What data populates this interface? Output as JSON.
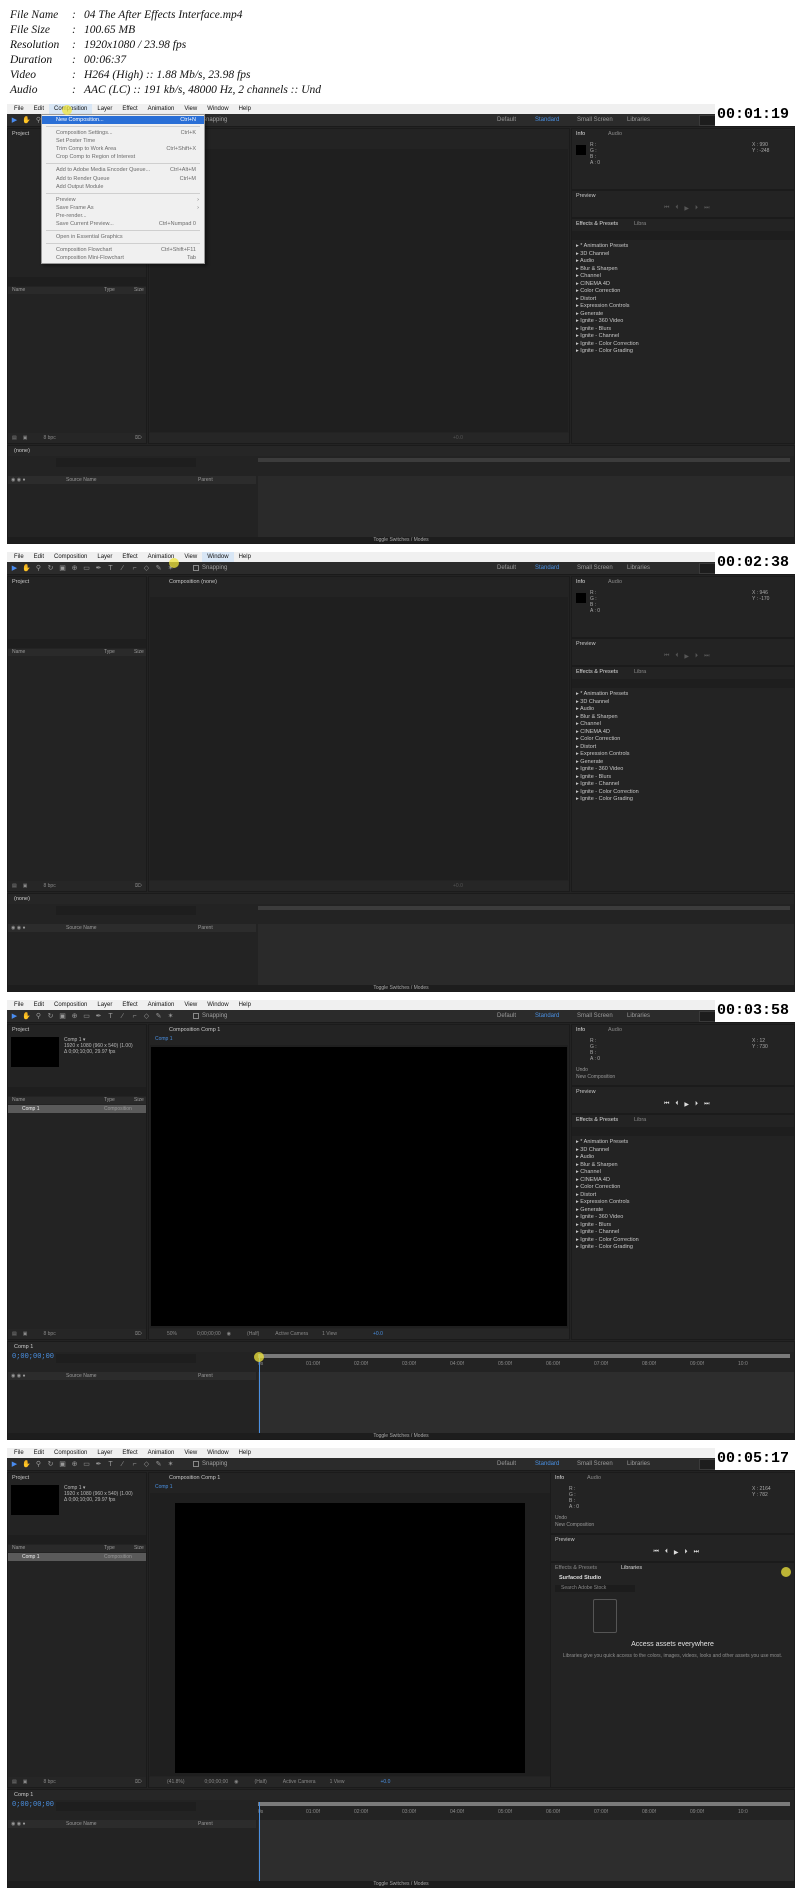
{
  "meta": {
    "rows": [
      {
        "key": "File Name",
        "value": "04 The After Effects Interface.mp4"
      },
      {
        "key": "File Size",
        "value": "100.65 MB"
      },
      {
        "key": "Resolution",
        "value": "1920x1080 / 23.98 fps"
      },
      {
        "key": "Duration",
        "value": "00:06:37"
      },
      {
        "key": "Video",
        "value": "H264 (High) :: 1.88 Mb/s, 23.98 fps"
      },
      {
        "key": "Audio",
        "value": "AAC (LC) :: 191 kb/s, 48000 Hz, 2 channels :: Und"
      }
    ],
    "separator": ":"
  },
  "app": {
    "menus": [
      "File",
      "Edit",
      "Composition",
      "Layer",
      "Effect",
      "Animation",
      "View",
      "Window",
      "Help"
    ],
    "snapping": "Snapping",
    "workspaces": [
      "Default",
      "Standard",
      "Small Screen",
      "Libraries"
    ],
    "search_placeholder": "Search Help",
    "project_title": "Project",
    "name_col": "Name",
    "type_col": "Type",
    "size_col": "Size",
    "info_tab": "Info",
    "audio_tab": "Audio",
    "preview_tab": "Preview",
    "effects_tab": "Effects & Presets",
    "libraries_tab": "Libra",
    "libraries_tab_full": "Libraries",
    "bpc": "8 bpc",
    "none_label": "(none)",
    "source_name": "Source Name",
    "parent": "Parent",
    "toggle_modes": "Toggle Switches / Modes",
    "info_rgb": [
      "R :",
      "G :",
      "B :",
      "A : 0"
    ],
    "composition_none": "Composition (none)",
    "composition_comp1": "Composition Comp 1",
    "comp1": "Comp 1",
    "comp_summary": [
      "Comp 1 ▾",
      "1920 x 1080 (960 x 540) (1.00)",
      "Δ 0;00;10;00, 29.97 fps"
    ],
    "comp_type": "Composition",
    "undo_label": "Undo",
    "undo_value": "New Composition",
    "timecode": "0;00;00;00",
    "zoom_50": "50%",
    "zoom_418": "(41.8%)",
    "res_half": "(Half)",
    "active_camera": "Active Camera",
    "view_1": "1 View",
    "exposure": "+0.0",
    "surfaced_studio": "Surfaced Studio",
    "search_adobe_stock": "Search Adobe Stock",
    "access_title": "Access assets everywhere",
    "access_desc": "Libraries give you quick access to the colors, images, videos, looks and other assets you use most."
  },
  "effects_presets": [
    "* Animation Presets",
    "3D Channel",
    "Audio",
    "Blur & Sharpen",
    "Channel",
    "CINEMA 4D",
    "Color Correction",
    "Distort",
    "Expression Controls",
    "Generate",
    "Ignite - 360 Video",
    "Ignite - Blurs",
    "Ignite - Channel",
    "Ignite - Color Correction",
    "Ignite - Color Grading"
  ],
  "ruler_ticks": [
    "0s",
    "01:00f",
    "02:00f",
    "03:00f",
    "04:00f",
    "05:00f",
    "06:00f",
    "07:00f",
    "08:00f",
    "09:00f",
    "10:0"
  ],
  "composition_menu": [
    {
      "label": "New Composition...",
      "shortcut": "Ctrl+N",
      "state": "highlight"
    },
    {
      "sep": true
    },
    {
      "label": "Composition Settings...",
      "shortcut": "Ctrl+K",
      "state": "disabled"
    },
    {
      "label": "Set Poster Time",
      "shortcut": "",
      "state": "disabled"
    },
    {
      "label": "Trim Comp to Work Area",
      "shortcut": "Ctrl+Shift+X",
      "state": "disabled"
    },
    {
      "label": "Crop Comp to Region of Interest",
      "shortcut": "",
      "state": "disabled"
    },
    {
      "sep": true
    },
    {
      "label": "Add to Adobe Media Encoder Queue...",
      "shortcut": "Ctrl+Alt+M",
      "state": "disabled"
    },
    {
      "label": "Add to Render Queue",
      "shortcut": "Ctrl+M",
      "state": "disabled"
    },
    {
      "label": "Add Output Module",
      "shortcut": "",
      "state": "disabled"
    },
    {
      "sep": true
    },
    {
      "label": "Preview",
      "shortcut": "",
      "state": "disabled",
      "submenu": true
    },
    {
      "label": "Save Frame As",
      "shortcut": "",
      "state": "disabled",
      "submenu": true
    },
    {
      "label": "Pre-render...",
      "shortcut": "",
      "state": "disabled"
    },
    {
      "label": "Save Current Preview...",
      "shortcut": "Ctrl+Numpad 0",
      "state": "disabled"
    },
    {
      "sep": true
    },
    {
      "label": "Open in Essential Graphics",
      "shortcut": "",
      "state": "disabled"
    },
    {
      "sep": true
    },
    {
      "label": "Composition Flowchart",
      "shortcut": "Ctrl+Shift+F11",
      "state": "disabled"
    },
    {
      "label": "Composition Mini-Flowchart",
      "shortcut": "Tab",
      "state": "disabled"
    }
  ],
  "frames": [
    {
      "timestamp": "00:01:19",
      "info_xy": [
        "X : 990",
        "Y : -248"
      ]
    },
    {
      "timestamp": "00:02:38",
      "info_xy": [
        "X : 946",
        "Y : -170"
      ]
    },
    {
      "timestamp": "00:03:58",
      "info_xy": [
        "X : 12",
        "Y : 730"
      ]
    },
    {
      "timestamp": "00:05:17",
      "info_xy": [
        "X : 2164",
        "Y : 782"
      ]
    }
  ],
  "colors": {
    "accent": "#4a90e2",
    "menu_highlight": "#2a6fd6",
    "panel": "#232323",
    "timestamp_bg": "#ffffff"
  }
}
